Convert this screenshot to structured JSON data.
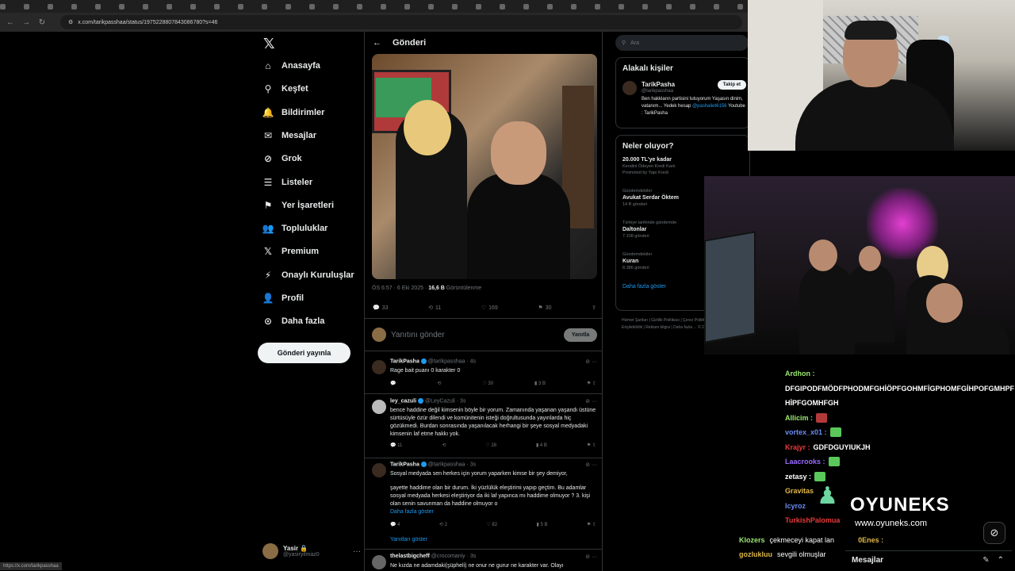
{
  "browser": {
    "url": "x.com/tarikpasshaa/status/1975228807843086780?s=46",
    "status_link": "https://x.com/tarikpasshaa"
  },
  "nav": {
    "items": [
      {
        "label": "Anasayfa",
        "icon": "home-icon"
      },
      {
        "label": "Keşfet",
        "icon": "search-icon"
      },
      {
        "label": "Bildirimler",
        "icon": "bell-icon"
      },
      {
        "label": "Mesajlar",
        "icon": "mail-icon"
      },
      {
        "label": "Grok",
        "icon": "grok-icon"
      },
      {
        "label": "Listeler",
        "icon": "list-icon"
      },
      {
        "label": "Yer İşaretleri",
        "icon": "bookmark-icon"
      },
      {
        "label": "Topluluklar",
        "icon": "people-icon"
      },
      {
        "label": "Premium",
        "icon": "x-logo-icon"
      },
      {
        "label": "Onaylı Kuruluşlar",
        "icon": "lightning-icon"
      },
      {
        "label": "Profil",
        "icon": "person-icon"
      },
      {
        "label": "Daha fazla",
        "icon": "more-circle-icon"
      }
    ],
    "post_button": "Gönderi yayınla",
    "profile": {
      "name": "Yasir 🔒",
      "handle": "@yasiryilmaz0"
    }
  },
  "main": {
    "title": "Gönderi",
    "post_time": "ÖS 6:57 · 6 Eki 2025 ·",
    "views": "16,6 B",
    "views_label": "Görüntülenme",
    "stats": {
      "replies": "33",
      "reposts": "11",
      "likes": "169",
      "bookmarks": "30"
    },
    "reply_placeholder": "Yanıtını gönder",
    "reply_button": "Yanıtla",
    "replies": [
      {
        "name": "TarikPasha",
        "handle": "@tarikpasshaa · 4s",
        "text": "Rage bait puanı 0 karakter 0",
        "stats": {
          "replies": "",
          "reposts": "",
          "likes": "30",
          "views": "3 B"
        }
      },
      {
        "name": "ley_cazuli",
        "handle": "@LeyCazuli · 3s",
        "text": "bence haddine değil kimsenin böyle bir yorum. Zamanında yaşanan yaşandı üstüne sürtüsüyle özür dilendi ve komünitenin isteği doğrultusunda yayınlarda hiç gözükmedi. Burdan sonrasında yaşanılacak herhangi bir şeye sosyal medyadaki kimsenin laf etme hakkı yok.",
        "stats": {
          "replies": "11",
          "reposts": "",
          "likes": "28",
          "views": "4 B"
        }
      },
      {
        "name": "TarikPasha",
        "handle": "@tarikpasshaa · 3s",
        "text": "Sosyal medyada sen herkes için yorum yaparken kimse bir şey demiyor,",
        "text2": "şayette haddime olan bir durum. İki yüzlülük eleştirimi yapıp geçtim. Bu adamlar sosyal medyada herkesi eleştiriyor da iki laf yapınca mı haddime olmuyor ? 3. kişi olan senin savunman da haddine olmuyor o",
        "more": "Daha fazla göster",
        "stats": {
          "replies": "4",
          "reposts": "2",
          "likes": "82",
          "views": "5 B"
        }
      },
      {
        "name": "thelastbigcheff",
        "handle": "@crocomaniy · 3s",
        "text": "Ne kızda ne adamdaki(şüpheli) ne onur ne gurur ne karakter var. Olayı"
      }
    ],
    "show_replies": "Yanıtları göster"
  },
  "right": {
    "search_placeholder": "Ara",
    "related_title": "Alakalı kişiler",
    "person": {
      "name": "TarikPasha",
      "handle": "@tarikpasshaa",
      "bio": "Ben hakkların partisini tutuyorum Yaşasın dinim, vatanım... Yedek hesap",
      "bio_link": "@pashaliet6156",
      "bio_tail": "Youtube : TarikPasha",
      "follow": "Takip et"
    },
    "trends_title": "Neler oluyor?",
    "trends": [
      {
        "ctx": "",
        "title": "20.000 TL'ye kadar",
        "count": "Kendini Ödeyen Kredi Kartı",
        "extra": "Promoted by Yapı Kredi"
      },
      {
        "ctx": "Gündemdekiler",
        "title": "Avukat Serdar Öktem",
        "count": "14 B gönderi"
      },
      {
        "ctx": "Türkiye tarihinde gündemde",
        "title": "Daltonlar",
        "count": "7.108 gönderi"
      },
      {
        "ctx": "Gündemdekiler",
        "title": "Kuran",
        "count": "8.386 gönderi"
      }
    ],
    "show_more": "Daha fazla göster",
    "footer": "Hizmet Şartları | Gizlilik Politikası | Çerez Politikası | İmprint | Erişilebilirlik | Reklam bilgisi | Daha fazla ... © 2025 X Corp."
  },
  "chat": {
    "lines": [
      {
        "user": "Ardhon :",
        "color": "#9be870",
        "msg": ""
      },
      {
        "user": "",
        "color": "#ffffff",
        "msg": "DFGIPODFMÖDFPHODMFGHİÖPFGOHMFİGPHOMFGİHPOFGMHPF"
      },
      {
        "user": "",
        "color": "#ffffff",
        "msg": "HİPFGOMHFGH"
      },
      {
        "user": "Allicim :",
        "color": "#9be870",
        "msg": "",
        "emote": "#b33a3a"
      },
      {
        "user": "vortex_x01 :",
        "color": "#6a8cf0",
        "msg": "",
        "emote": "#5ac85a"
      },
      {
        "user": "Krajyr :",
        "color": "#e83a3a",
        "msg": "GDFDGUYIUKJH"
      },
      {
        "user": "Laacrooks :",
        "color": "#9a6aff",
        "msg": "",
        "emote": "#5ac85a"
      },
      {
        "user": "zetasy :",
        "color": "#ffffff",
        "msg": "",
        "emote": "#5ac85a"
      },
      {
        "user": "Gravitas",
        "color": "#e0b84a",
        "msg": ""
      },
      {
        "user": "Icyroz",
        "color": "#6a8cf0",
        "msg": ""
      },
      {
        "user": "TurkishPalomua",
        "color": "#e83a3a",
        "msg": ""
      }
    ],
    "bottom": [
      {
        "user": "Klozers",
        "color": "#9be870",
        "msg": "çekmeceyi kapat lan"
      },
      {
        "user": "gozlukluu",
        "color": "#e0b84a",
        "msg": "sevgili olmuşlar"
      }
    ],
    "enes": "0Enes :"
  },
  "overlay": {
    "brand": "OYUNEKS",
    "site": "www.oyuneks.com"
  },
  "messages_bar": "Mesajlar"
}
